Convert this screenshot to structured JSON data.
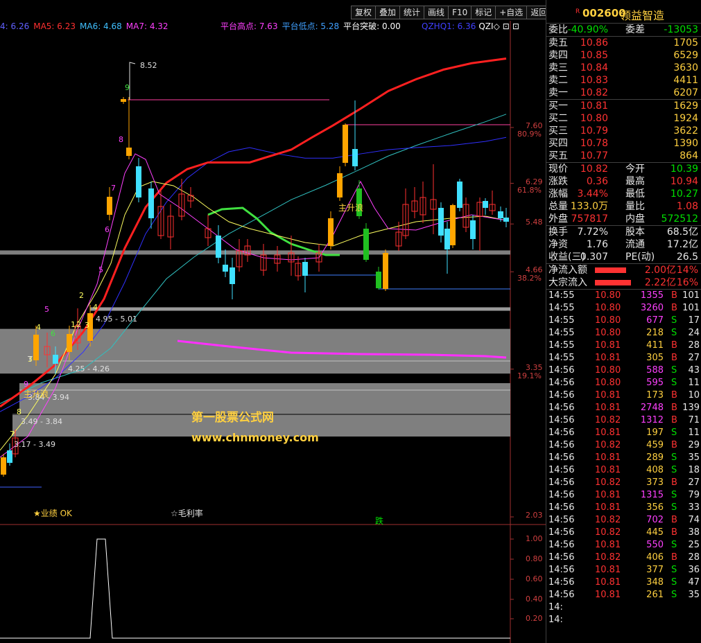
{
  "toolbar": {
    "buttons": [
      "复权",
      "叠加",
      "统计",
      "画线",
      "F10",
      "标记",
      "+自选",
      "返回"
    ]
  },
  "ma_legend": [
    {
      "text": "4: 6.26",
      "color": "#6060ff"
    },
    {
      "text": "MA5: 6.23",
      "color": "#ff3030"
    },
    {
      "text": "MA6: 4.68",
      "color": "#40c0ff"
    },
    {
      "text": "MA7: 4.32",
      "color": "#ff40ff"
    }
  ],
  "platform_legend": [
    {
      "text": "平台高点: 7.63",
      "color": "#ff40ff"
    },
    {
      "text": "平台低点: 5.28",
      "color": "#40a0ff"
    },
    {
      "text": "平台突破: 0.00",
      "color": "#ffffff"
    }
  ],
  "qz_legend": [
    {
      "text": "QZHQ1: 6.36",
      "color": "#4040ff"
    },
    {
      "text": "QZI◇",
      "color": "#ffffff"
    },
    {
      "text": "⊡",
      "color": "#ffffff"
    },
    {
      "text": "⊡",
      "color": "#ffffff"
    }
  ],
  "price_axis": [
    {
      "price": 7.6,
      "pct": "80.9%"
    },
    {
      "price": 6.29,
      "pct": "61.8%"
    },
    {
      "price": 5.48,
      "pct": ""
    },
    {
      "price": 4.66,
      "pct": "38.2%"
    },
    {
      "price": 3.35,
      "pct": "19.1%"
    },
    {
      "price": 2.03,
      "pct": ""
    }
  ],
  "indicator_axis": [
    "1.00",
    "0.80",
    "0.60",
    "0.40",
    "0.20"
  ],
  "chart_annotations": {
    "peak": "8.52",
    "zone1": "4.95 - 5.01",
    "zone2": "4.25 - 4.26",
    "zone3": "3.84 - 3.94",
    "zone4": "3.49 - 3.84",
    "zone5": "3.17 - 3.49",
    "rise1": "主升浪",
    "rise2": "主升浪",
    "perf": "★业绩 OK",
    "margin": "☆毛利率",
    "drop": "跌",
    "watermark1": "第一股票公式网",
    "watermark2": "www.chnmoney.com",
    "count_labels": [
      "2",
      "3",
      "4",
      "5",
      "6",
      "7",
      "8",
      "9",
      "1",
      "2",
      "3",
      "4",
      "5",
      "6",
      "7",
      "8",
      "9",
      "T"
    ]
  },
  "stock": {
    "code": "002600",
    "name": "领益智造",
    "mark": "R"
  },
  "webi": {
    "label1": "委比",
    "value1": "-40.90%",
    "label2": "委差",
    "value2": "-13053"
  },
  "asks": [
    {
      "label": "卖五",
      "price": "10.86",
      "vol": "1705"
    },
    {
      "label": "卖四",
      "price": "10.85",
      "vol": "6529"
    },
    {
      "label": "卖三",
      "price": "10.84",
      "vol": "3630"
    },
    {
      "label": "卖二",
      "price": "10.83",
      "vol": "4411"
    },
    {
      "label": "卖一",
      "price": "10.82",
      "vol": "6207"
    }
  ],
  "bids": [
    {
      "label": "买一",
      "price": "10.81",
      "vol": "1629"
    },
    {
      "label": "买二",
      "price": "10.80",
      "vol": "1924"
    },
    {
      "label": "买三",
      "price": "10.79",
      "vol": "3622"
    },
    {
      "label": "买四",
      "price": "10.78",
      "vol": "1390"
    },
    {
      "label": "买五",
      "price": "10.77",
      "vol": "864"
    }
  ],
  "stats": [
    {
      "l1": "现价",
      "v1": "10.82",
      "c1": "red",
      "l2": "今开",
      "v2": "10.39",
      "c2": "green"
    },
    {
      "l1": "涨跌",
      "v1": "0.36",
      "c1": "red",
      "l2": "最高",
      "v2": "10.94",
      "c2": "red"
    },
    {
      "l1": "涨幅",
      "v1": "3.44%",
      "c1": "red",
      "l2": "最低",
      "v2": "10.27",
      "c2": "green"
    },
    {
      "l1": "总量",
      "v1": "133.0万",
      "c1": "yellow",
      "l2": "量比",
      "v2": "1.08",
      "c2": "red"
    },
    {
      "l1": "外盘",
      "v1": "757817",
      "c1": "red",
      "l2": "内盘",
      "v2": "572512",
      "c2": "green"
    }
  ],
  "finance": [
    {
      "l1": "换手",
      "v1": "7.72%",
      "l2": "股本",
      "v2": "68.5亿"
    },
    {
      "l1": "净资",
      "v1": "1.76",
      "l2": "流通",
      "v2": "17.2亿"
    },
    {
      "l1": "收益(三)",
      "v1": "0.307",
      "l2": "PE(动)",
      "v2": "26.5"
    }
  ],
  "flows": [
    {
      "label": "净流入额",
      "value": "2.00亿",
      "pct": "14%",
      "bar": 0.5
    },
    {
      "label": "大宗流入",
      "value": "2.22亿",
      "pct": "16%",
      "bar": 0.58
    }
  ],
  "trades": [
    {
      "t": "14:55",
      "p": "10.80",
      "v": "1355",
      "bs": "B",
      "n": "101",
      "vc": "magenta"
    },
    {
      "t": "14:55",
      "p": "10.80",
      "v": "3260",
      "bs": "B",
      "n": "101",
      "vc": "magenta"
    },
    {
      "t": "14:55",
      "p": "10.80",
      "v": "677",
      "bs": "S",
      "n": "17",
      "vc": "magenta"
    },
    {
      "t": "14:55",
      "p": "10.80",
      "v": "218",
      "bs": "S",
      "n": "24",
      "vc": "yellow"
    },
    {
      "t": "14:55",
      "p": "10.81",
      "v": "411",
      "bs": "B",
      "n": "28",
      "vc": "yellow"
    },
    {
      "t": "14:55",
      "p": "10.81",
      "v": "305",
      "bs": "B",
      "n": "27",
      "vc": "yellow"
    },
    {
      "t": "14:56",
      "p": "10.80",
      "v": "588",
      "bs": "S",
      "n": "43",
      "vc": "magenta"
    },
    {
      "t": "14:56",
      "p": "10.80",
      "v": "595",
      "bs": "S",
      "n": "11",
      "vc": "magenta"
    },
    {
      "t": "14:56",
      "p": "10.81",
      "v": "173",
      "bs": "B",
      "n": "10",
      "vc": "yellow"
    },
    {
      "t": "14:56",
      "p": "10.81",
      "v": "2748",
      "bs": "B",
      "n": "139",
      "vc": "magenta"
    },
    {
      "t": "14:56",
      "p": "10.82",
      "v": "1312",
      "bs": "B",
      "n": "71",
      "vc": "magenta"
    },
    {
      "t": "14:56",
      "p": "10.81",
      "v": "197",
      "bs": "S",
      "n": "11",
      "vc": "yellow"
    },
    {
      "t": "14:56",
      "p": "10.82",
      "v": "459",
      "bs": "B",
      "n": "29",
      "vc": "yellow"
    },
    {
      "t": "14:56",
      "p": "10.81",
      "v": "289",
      "bs": "S",
      "n": "35",
      "vc": "yellow"
    },
    {
      "t": "14:56",
      "p": "10.81",
      "v": "408",
      "bs": "S",
      "n": "18",
      "vc": "yellow"
    },
    {
      "t": "14:56",
      "p": "10.82",
      "v": "373",
      "bs": "B",
      "n": "27",
      "vc": "yellow"
    },
    {
      "t": "14:56",
      "p": "10.81",
      "v": "1315",
      "bs": "S",
      "n": "79",
      "vc": "magenta"
    },
    {
      "t": "14:56",
      "p": "10.81",
      "v": "356",
      "bs": "S",
      "n": "33",
      "vc": "yellow"
    },
    {
      "t": "14:56",
      "p": "10.82",
      "v": "702",
      "bs": "B",
      "n": "74",
      "vc": "magenta"
    },
    {
      "t": "14:56",
      "p": "10.82",
      "v": "445",
      "bs": "B",
      "n": "38",
      "vc": "yellow"
    },
    {
      "t": "14:56",
      "p": "10.81",
      "v": "550",
      "bs": "S",
      "n": "25",
      "vc": "magenta"
    },
    {
      "t": "14:56",
      "p": "10.82",
      "v": "406",
      "bs": "B",
      "n": "28",
      "vc": "yellow"
    },
    {
      "t": "14:56",
      "p": "10.81",
      "v": "377",
      "bs": "S",
      "n": "36",
      "vc": "yellow"
    },
    {
      "t": "14:56",
      "p": "10.81",
      "v": "348",
      "bs": "S",
      "n": "47",
      "vc": "yellow"
    },
    {
      "t": "14:56",
      "p": "10.81",
      "v": "261",
      "bs": "S",
      "n": "35",
      "vc": "yellow"
    },
    {
      "t": "14:",
      "p": "",
      "v": "",
      "bs": "",
      "n": "",
      "vc": "yellow"
    },
    {
      "t": "14:",
      "p": "",
      "v": "",
      "bs": "",
      "n": "",
      "vc": "yellow"
    }
  ]
}
